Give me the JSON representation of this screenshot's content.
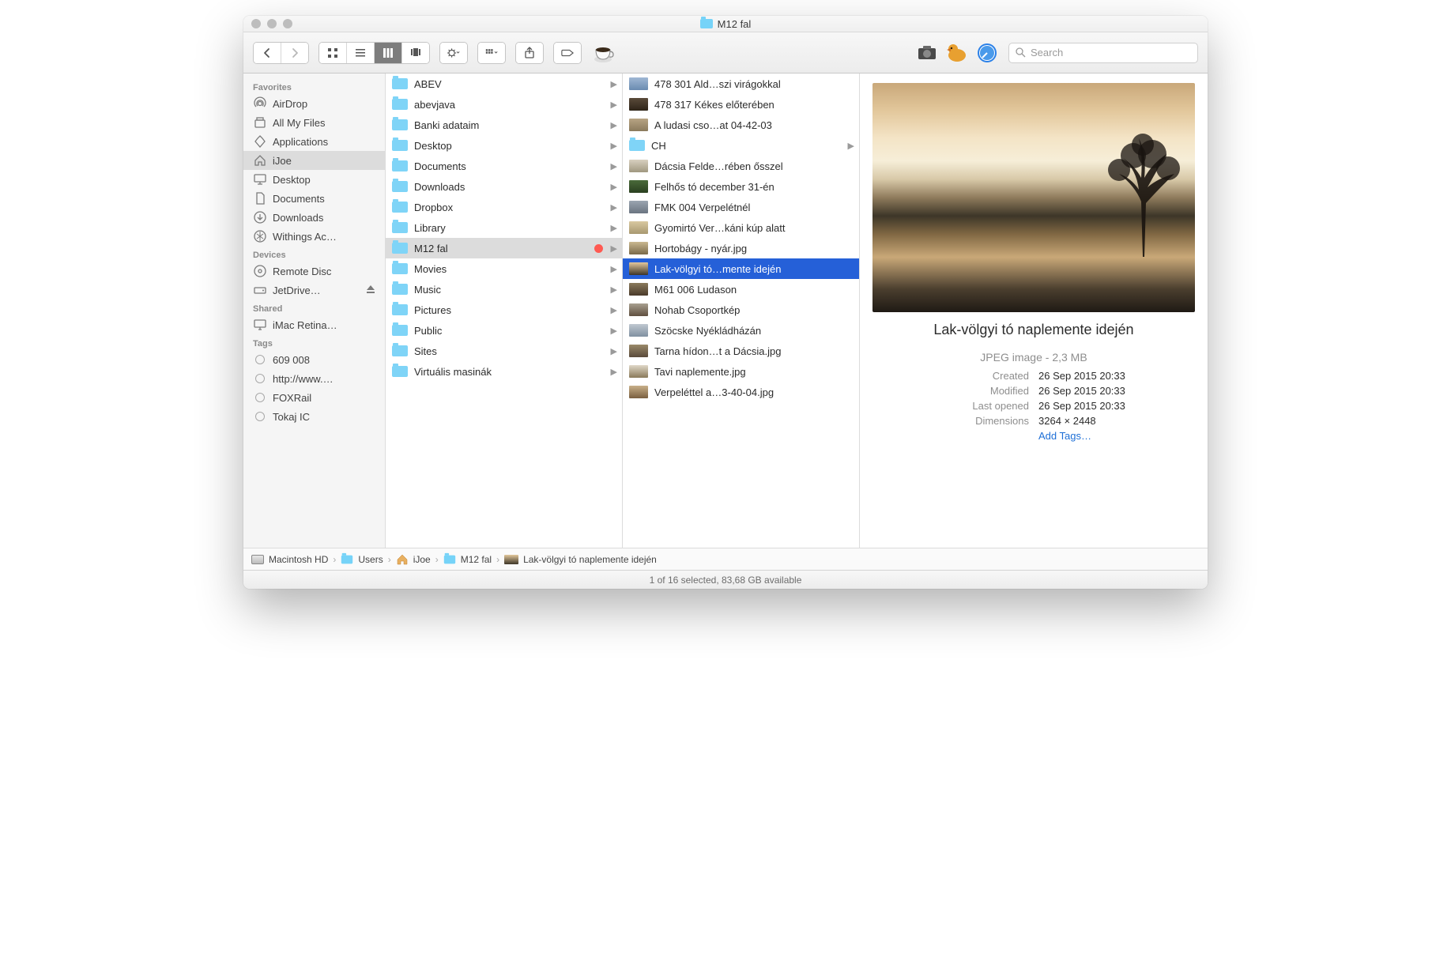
{
  "window": {
    "title": "M12 fal"
  },
  "search": {
    "placeholder": "Search"
  },
  "sidebar": {
    "sections": [
      {
        "header": "Favorites",
        "items": [
          {
            "icon": "airdrop",
            "label": "AirDrop"
          },
          {
            "icon": "allfiles",
            "label": "All My Files"
          },
          {
            "icon": "apps",
            "label": "Applications"
          },
          {
            "icon": "home",
            "label": "iJoe",
            "selected": true
          },
          {
            "icon": "desktop",
            "label": "Desktop"
          },
          {
            "icon": "documents",
            "label": "Documents"
          },
          {
            "icon": "downloads",
            "label": "Downloads"
          },
          {
            "icon": "withings",
            "label": "Withings Ac…"
          }
        ]
      },
      {
        "header": "Devices",
        "items": [
          {
            "icon": "disc",
            "label": "Remote Disc"
          },
          {
            "icon": "drive",
            "label": "JetDrive…",
            "eject": true
          }
        ]
      },
      {
        "header": "Shared",
        "items": [
          {
            "icon": "imac",
            "label": "iMac Retina…"
          }
        ]
      },
      {
        "header": "Tags",
        "items": [
          {
            "icon": "tag",
            "label": "609 008"
          },
          {
            "icon": "tag",
            "label": "http://www.…"
          },
          {
            "icon": "tag",
            "label": "FOXRail"
          },
          {
            "icon": "tag",
            "label": "Tokaj IC"
          }
        ]
      }
    ]
  },
  "column1": [
    {
      "type": "folder",
      "name": "ABEV",
      "arrow": true
    },
    {
      "type": "folder",
      "name": "abevjava",
      "arrow": true
    },
    {
      "type": "folder",
      "name": "Banki adataim",
      "arrow": true
    },
    {
      "type": "folder",
      "name": "Desktop",
      "arrow": true
    },
    {
      "type": "folder",
      "name": "Documents",
      "arrow": true
    },
    {
      "type": "folder",
      "name": "Downloads",
      "arrow": true
    },
    {
      "type": "folder",
      "name": "Dropbox",
      "arrow": true
    },
    {
      "type": "folder",
      "name": "Library",
      "arrow": true
    },
    {
      "type": "folder",
      "name": "M12 fal",
      "arrow": true,
      "selected": true,
      "redTag": true
    },
    {
      "type": "folder",
      "name": "Movies",
      "arrow": true
    },
    {
      "type": "folder",
      "name": "Music",
      "arrow": true
    },
    {
      "type": "folder",
      "name": "Pictures",
      "arrow": true
    },
    {
      "type": "folder",
      "name": "Public",
      "arrow": true
    },
    {
      "type": "folder",
      "name": "Sites",
      "arrow": true
    },
    {
      "type": "folder",
      "name": "Virtuális masinák",
      "arrow": true
    }
  ],
  "column2": [
    {
      "type": "img",
      "th": "th1",
      "name": "478 301 Ald…szi virágokkal"
    },
    {
      "type": "img",
      "th": "th2",
      "name": "478 317 Kékes előterében"
    },
    {
      "type": "img",
      "th": "th3",
      "name": "A ludasi cso…at 04-42-03"
    },
    {
      "type": "folder",
      "name": "CH",
      "arrow": true
    },
    {
      "type": "img",
      "th": "th4",
      "name": "Dácsia Felde…rében ősszel"
    },
    {
      "type": "img",
      "th": "th5",
      "name": "Felhős tó december 31-én"
    },
    {
      "type": "img",
      "th": "th6",
      "name": "FMK 004 Verpelétnél"
    },
    {
      "type": "img",
      "th": "th7",
      "name": "Gyomirtó Ver…káni kúp alatt"
    },
    {
      "type": "img",
      "th": "th8",
      "name": "Hortobágy - nyár.jpg"
    },
    {
      "type": "img",
      "th": "th9",
      "name": "Lak-völgyi tó…mente idején",
      "highlight": true
    },
    {
      "type": "img",
      "th": "th10",
      "name": "M61 006 Ludason"
    },
    {
      "type": "img",
      "th": "th11",
      "name": "Nohab Csoportkép"
    },
    {
      "type": "img",
      "th": "th12",
      "name": "Szöcske Nyékládházán"
    },
    {
      "type": "img",
      "th": "th13",
      "name": "Tarna hídon…t a Dácsia.jpg"
    },
    {
      "type": "img",
      "th": "th14",
      "name": "Tavi naplemente.jpg"
    },
    {
      "type": "img",
      "th": "th15",
      "name": "Verpeléttel a…3-40-04.jpg"
    }
  ],
  "preview": {
    "title": "Lak-völgyi tó naplemente idején",
    "typeSize": "JPEG image - 2,3 MB",
    "meta": {
      "Created": "26 Sep 2015 20:33",
      "Modified": "26 Sep 2015 20:33",
      "Last opened": "26 Sep 2015 20:33",
      "Dimensions": "3264 × 2448"
    },
    "addTags": "Add Tags…"
  },
  "pathbar": [
    {
      "icon": "hd",
      "label": "Macintosh HD"
    },
    {
      "icon": "folder",
      "label": "Users"
    },
    {
      "icon": "home",
      "label": "iJoe"
    },
    {
      "icon": "folder",
      "label": "M12 fal"
    },
    {
      "icon": "thumb",
      "label": "Lak-völgyi tó naplemente idején"
    }
  ],
  "status": "1 of 16 selected, 83,68 GB available"
}
